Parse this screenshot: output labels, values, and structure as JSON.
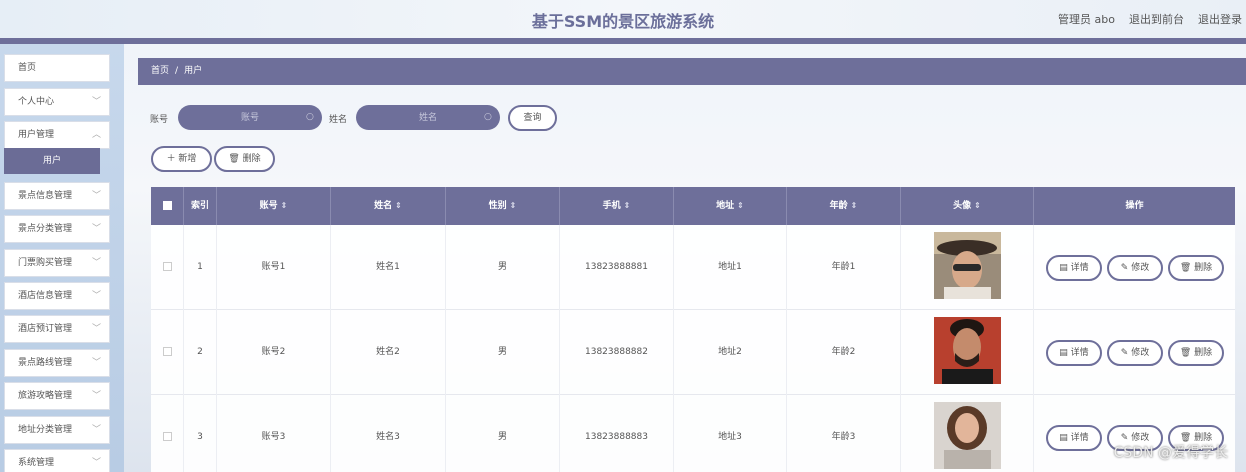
{
  "header": {
    "title": "基于SSM的景区旅游系统",
    "links": [
      "管理员 abo",
      "退出到前台",
      "退出登录"
    ]
  },
  "sidebar": {
    "items": [
      {
        "label": "首页",
        "chevron": false
      },
      {
        "label": "个人中心",
        "chevron": true
      },
      {
        "label": "用户管理",
        "chevron": true
      },
      {
        "label": "景点信息管理",
        "chevron": true
      },
      {
        "label": "景点分类管理",
        "chevron": true
      },
      {
        "label": "门票购买管理",
        "chevron": true
      },
      {
        "label": "酒店信息管理",
        "chevron": true
      },
      {
        "label": "酒店预订管理",
        "chevron": true
      },
      {
        "label": "景点路线管理",
        "chevron": true
      },
      {
        "label": "旅游攻略管理",
        "chevron": true
      },
      {
        "label": "地址分类管理",
        "chevron": true
      },
      {
        "label": "系统管理",
        "chevron": true
      }
    ],
    "active_sub": "用户"
  },
  "breadcrumb": {
    "home": "首页",
    "separator": "/",
    "current": "用户"
  },
  "search": {
    "account_label": "账号",
    "account_placeholder": "账号",
    "name_label": "姓名",
    "name_placeholder": "姓名",
    "query_button": "查询"
  },
  "actions": {
    "add": "＋ 新增",
    "delete": "🗑 删除"
  },
  "table": {
    "headers": [
      "索引",
      "账号",
      "姓名",
      "性别",
      "手机",
      "地址",
      "年龄",
      "头像",
      "操作"
    ],
    "rows": [
      {
        "index": "1",
        "account": "账号1",
        "name": "姓名1",
        "gender": "男",
        "phone": "13823888881",
        "address": "地址1",
        "age": "年龄1"
      },
      {
        "index": "2",
        "account": "账号2",
        "name": "姓名2",
        "gender": "男",
        "phone": "13823888882",
        "address": "地址2",
        "age": "年龄2"
      },
      {
        "index": "3",
        "account": "账号3",
        "name": "姓名3",
        "gender": "男",
        "phone": "13823888883",
        "address": "地址3",
        "age": "年龄3"
      }
    ],
    "row_actions": {
      "detail": "详情",
      "edit": "修改",
      "delete": "删除"
    }
  },
  "watermark": "CSDN @爱得学长",
  "colors": {
    "accent": "#6e6f9a",
    "sidebar_bg": "#c7d8ec"
  }
}
